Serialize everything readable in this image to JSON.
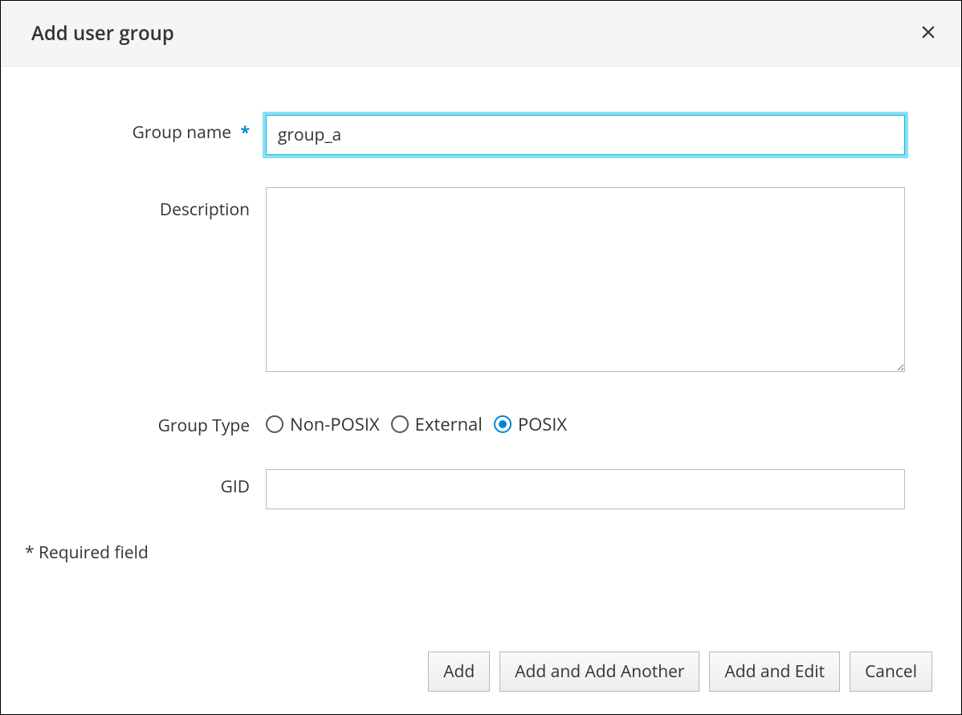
{
  "modal": {
    "title": "Add user group"
  },
  "form": {
    "group_name": {
      "label": "Group name",
      "required": true,
      "value": "group_a"
    },
    "description": {
      "label": "Description",
      "value": ""
    },
    "group_type": {
      "label": "Group Type",
      "options": [
        {
          "label": "Non-POSIX",
          "value": "nonposix",
          "checked": false
        },
        {
          "label": "External",
          "value": "external",
          "checked": false
        },
        {
          "label": "POSIX",
          "value": "posix",
          "checked": true
        }
      ]
    },
    "gid": {
      "label": "GID",
      "value": ""
    },
    "required_note": "* Required field"
  },
  "footer": {
    "add": "Add",
    "add_another": "Add and Add Another",
    "add_edit": "Add and Edit",
    "cancel": "Cancel"
  }
}
